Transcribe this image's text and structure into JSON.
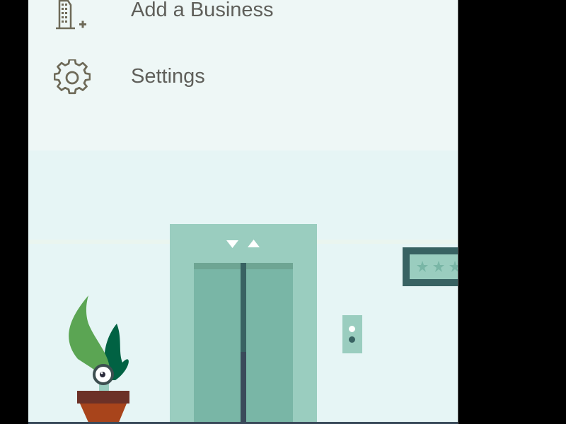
{
  "menu": {
    "items": [
      {
        "label": "Add a Business",
        "icon": "building-add-icon"
      },
      {
        "label": "Settings",
        "icon": "gear-icon"
      }
    ]
  },
  "illustration": {
    "elevator_indicators": [
      "down-arrow",
      "up-arrow"
    ],
    "rating_stars_visible": 3,
    "colors": {
      "frame": "#9acdbf",
      "door": "#79b6a6",
      "door_seam": "#386262",
      "sign_border": "#386262",
      "pot_rim": "#6c3127",
      "pot": "#a8441b",
      "leaf_light": "#5ba553",
      "leaf_dark": "#016243"
    }
  }
}
